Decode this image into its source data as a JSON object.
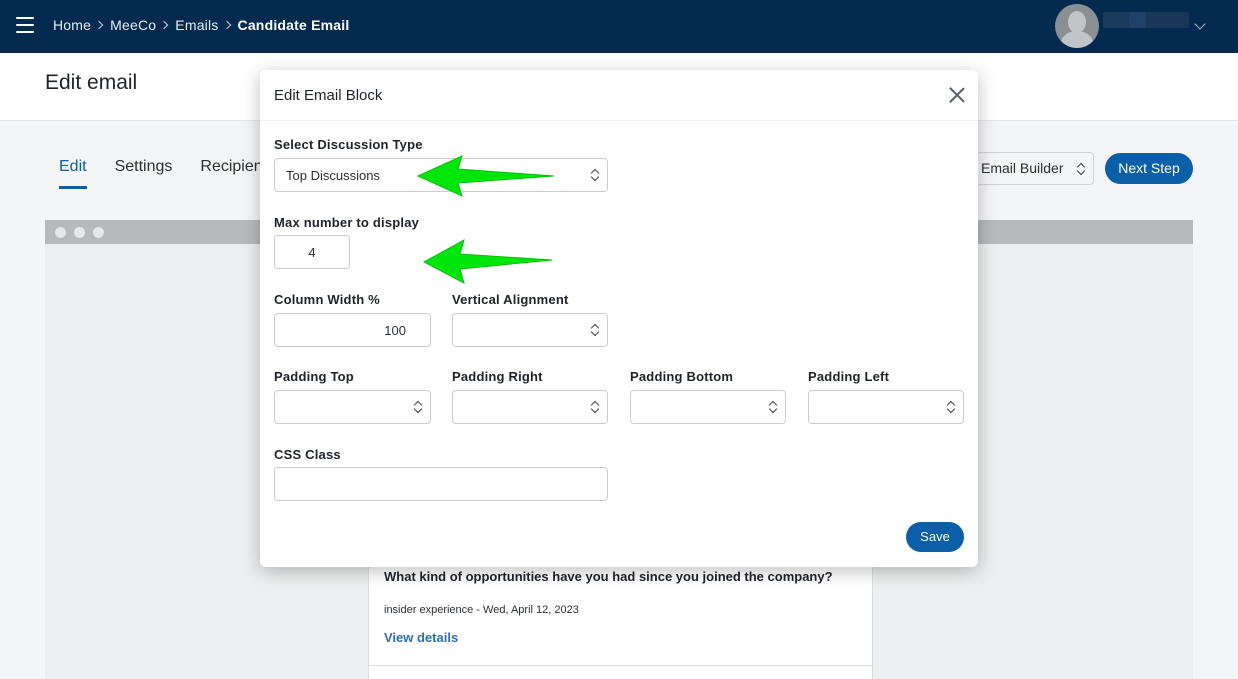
{
  "topbar": {
    "breadcrumb": [
      "Home",
      "MeeCo",
      "Emails",
      "Candidate Email"
    ]
  },
  "page": {
    "title": "Edit email"
  },
  "tabs": [
    {
      "label": "Edit",
      "active": true
    },
    {
      "label": "Settings",
      "active": false
    },
    {
      "label": "Recipien",
      "active": false
    }
  ],
  "toolbar": {
    "builder_select": "Email Builder",
    "next_step": "Next Step"
  },
  "email_preview": {
    "question": "What kind of opportunities have you had since you joined the company?",
    "meta": "insider experience - Wed, April 12, 2023",
    "link": "View details"
  },
  "modal": {
    "title": "Edit Email Block",
    "discussion_type_label": "Select Discussion Type",
    "discussion_type_value": "Top Discussions",
    "max_number_label": "Max number to display",
    "max_number_value": "4",
    "column_width_label": "Column Width %",
    "column_width_value": "100",
    "vertical_alignment_label": "Vertical Alignment",
    "padding_top_label": "Padding Top",
    "padding_right_label": "Padding Right",
    "padding_bottom_label": "Padding Bottom",
    "padding_left_label": "Padding Left",
    "css_class_label": "CSS Class",
    "save_label": "Save"
  },
  "colors": {
    "topbar": "#052a50",
    "primary": "#0b5ea8",
    "annotation_arrow": "#00e60a"
  }
}
